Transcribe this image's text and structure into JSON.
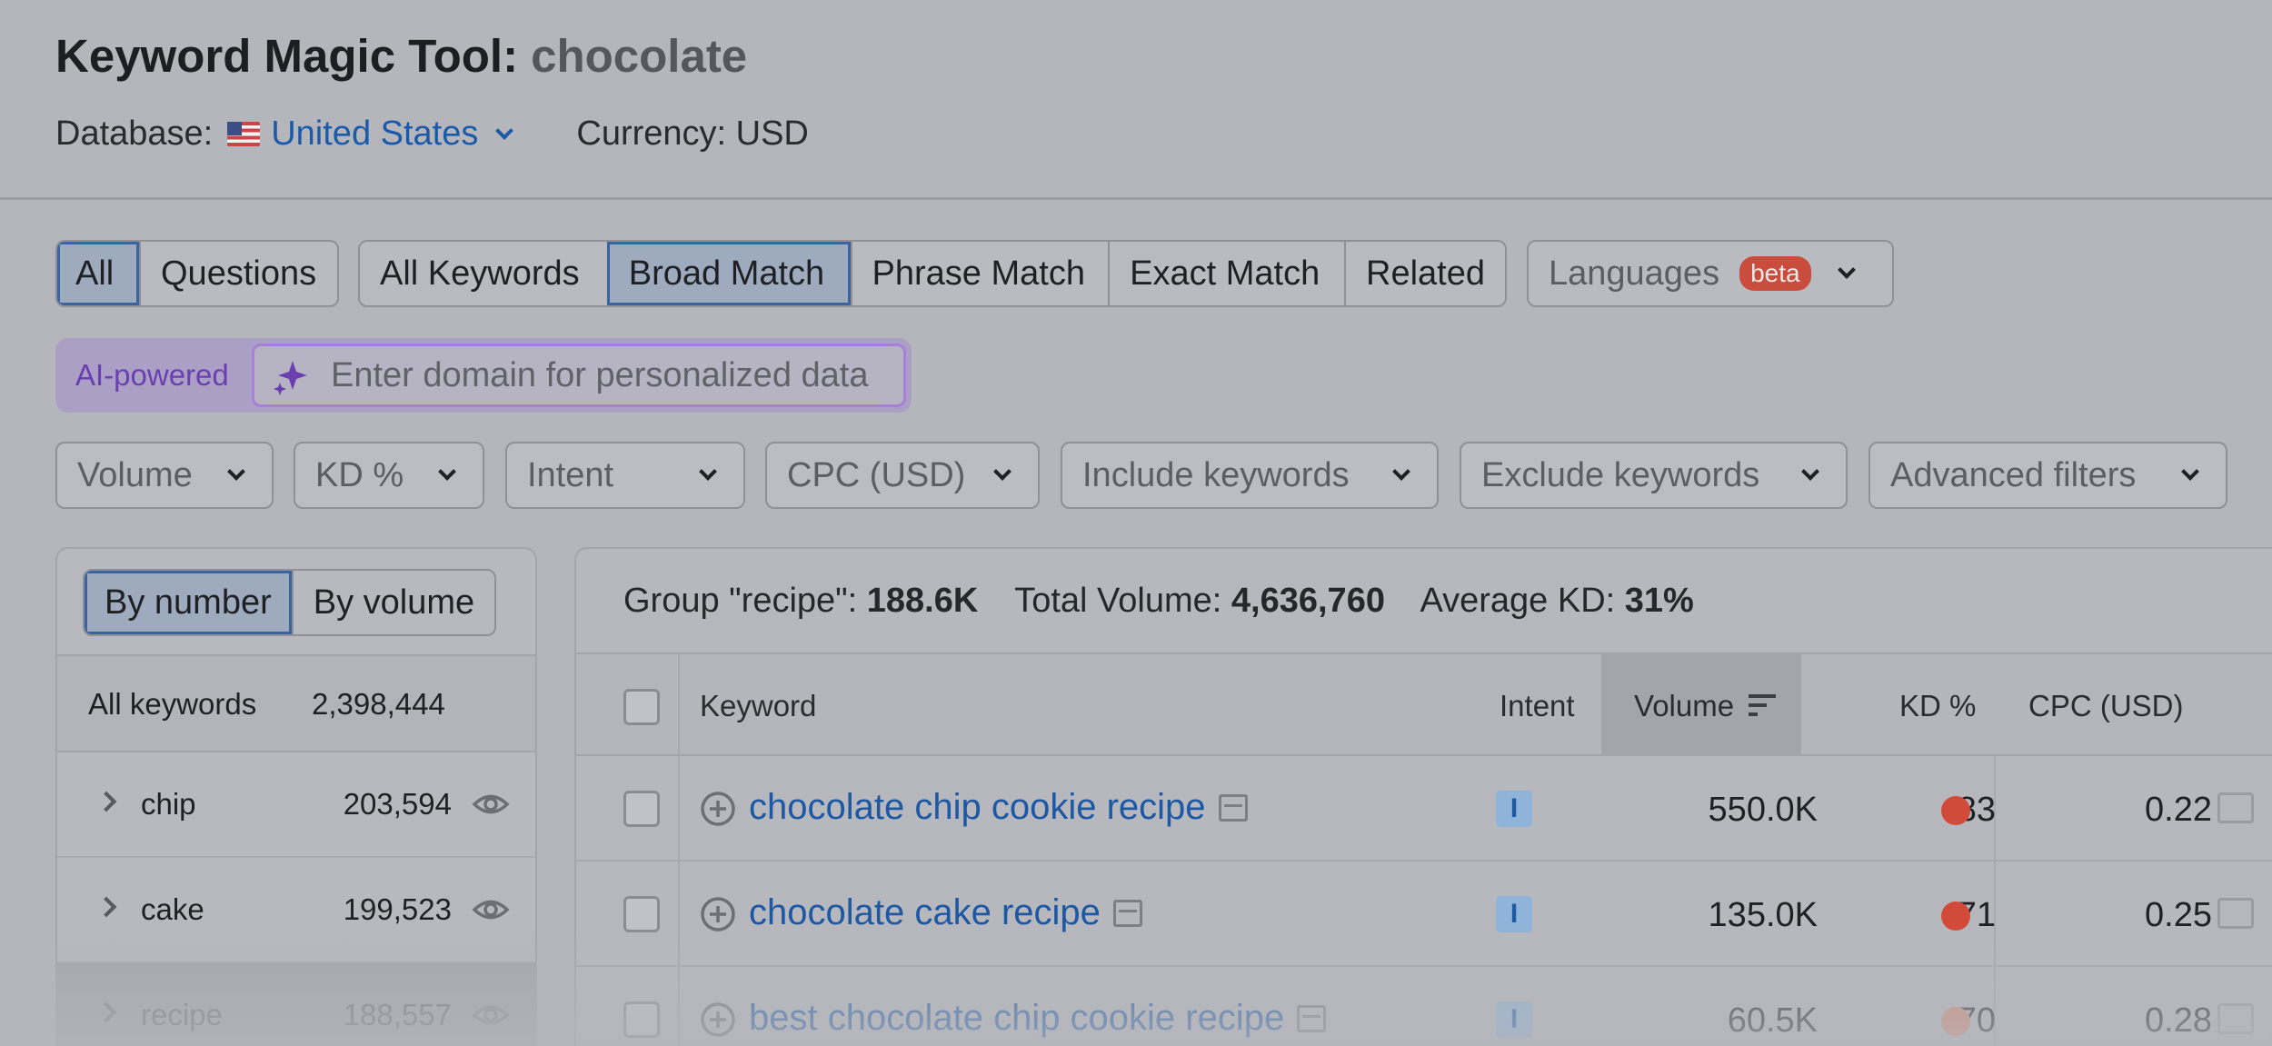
{
  "header": {
    "title": "Keyword Magic Tool:",
    "query": "chocolate",
    "database_label": "Database:",
    "database_value": "United States",
    "currency": "Currency: USD"
  },
  "question_toggle": [
    "All",
    "Questions"
  ],
  "match_tabs": [
    "All Keywords",
    "Broad Match",
    "Phrase Match",
    "Exact Match",
    "Related"
  ],
  "languages": {
    "label": "Languages",
    "badge": "beta"
  },
  "ai": {
    "label": "AI-powered",
    "placeholder": "Enter domain for personalized data"
  },
  "filters": [
    "Volume",
    "KD %",
    "Intent",
    "CPC (USD)",
    "Include keywords",
    "Exclude keywords",
    "Advanced filters"
  ],
  "groups": {
    "toggle": [
      "By number",
      "By volume"
    ],
    "all_label": "All keywords",
    "all_count": "2,398,444",
    "items": [
      {
        "name": "chip",
        "count": "203,594"
      },
      {
        "name": "cake",
        "count": "199,523"
      },
      {
        "name": "recipe",
        "count": "188,557"
      }
    ]
  },
  "summary": {
    "group_label": "Group \"recipe\":",
    "group_value": "188.6K",
    "total_label": "Total Volume:",
    "total_value": "4,636,760",
    "kd_label": "Average KD:",
    "kd_value": "31%"
  },
  "table": {
    "columns": {
      "keyword": "Keyword",
      "intent": "Intent",
      "volume": "Volume",
      "kd": "KD %",
      "cpc": "CPC (USD)"
    },
    "rows": [
      {
        "keyword": "chocolate chip cookie recipe",
        "intent": "I",
        "volume": "550.0K",
        "kd": "83",
        "cpc": "0.22"
      },
      {
        "keyword": "chocolate cake recipe",
        "intent": "I",
        "volume": "135.0K",
        "kd": "71",
        "cpc": "0.25"
      },
      {
        "keyword": "best chocolate chip cookie recipe",
        "intent": "I",
        "volume": "60.5K",
        "kd": "70",
        "cpc": "0.28"
      }
    ]
  },
  "colors": {
    "accent_blue": "#1c58a4",
    "kd_high": "#d24b3a",
    "ai_purple": "#6a3fb0",
    "beta_badge": "#c94c3c"
  }
}
